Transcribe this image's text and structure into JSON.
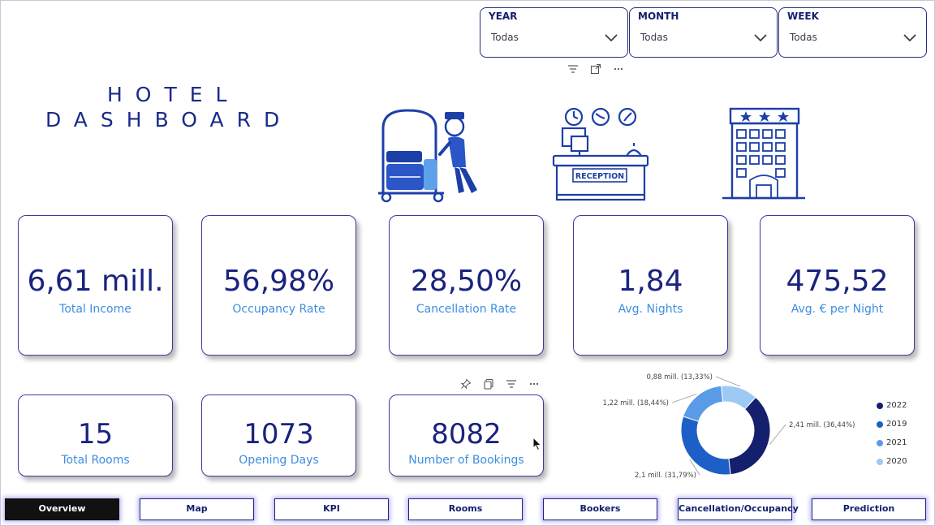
{
  "title_line1": "HOTEL",
  "title_line2": "DASHBOARD",
  "slicers": [
    {
      "label": "YEAR",
      "value": "Todas"
    },
    {
      "label": "MONTH",
      "value": "Todas"
    },
    {
      "label": "WEEK",
      "value": "Todas"
    }
  ],
  "reception_sign": "RECEPTION",
  "kpis": [
    {
      "value": "6,61 mill.",
      "label": "Total Income"
    },
    {
      "value": "56,98%",
      "label": "Occupancy Rate"
    },
    {
      "value": "28,50%",
      "label": "Cancellation Rate"
    },
    {
      "value": "1,84",
      "label": "Avg. Nights"
    },
    {
      "value": "475,52",
      "label": "Avg. € per Night"
    }
  ],
  "stats": [
    {
      "value": "15",
      "label": "Total Rooms"
    },
    {
      "value": "1073",
      "label": "Opening Days"
    },
    {
      "value": "8082",
      "label": "Number of Bookings"
    }
  ],
  "chart_data": {
    "type": "pie",
    "donut": true,
    "series": [
      {
        "name": "2022",
        "value": 2.41,
        "label": "2,41 mill. (36,44%)",
        "percent": 36.44,
        "color": "#14206e"
      },
      {
        "name": "2019",
        "value": 2.1,
        "label": "2,1 mill. (31,79%)",
        "percent": 31.79,
        "color": "#1d5fc7"
      },
      {
        "name": "2021",
        "value": 1.22,
        "label": "1,22 mill. (18,44%)",
        "percent": 18.44,
        "color": "#5a9be8"
      },
      {
        "name": "2020",
        "value": 0.88,
        "label": "0,88 mill. (13,33%)",
        "percent": 13.33,
        "color": "#9ccaf4"
      }
    ],
    "legend_position": "right"
  },
  "nav": [
    {
      "label": "Overview",
      "active": true
    },
    {
      "label": "Map",
      "active": false
    },
    {
      "label": "KPI",
      "active": false
    },
    {
      "label": "Rooms",
      "active": false
    },
    {
      "label": "Bookers",
      "active": false
    },
    {
      "label": "Cancellation/Occupancy",
      "active": false
    },
    {
      "label": "Prediction",
      "active": false
    }
  ],
  "colors": {
    "primary": "#1a237e",
    "accent": "#3e8ee0",
    "nav_glow": "#6e5ae6"
  }
}
